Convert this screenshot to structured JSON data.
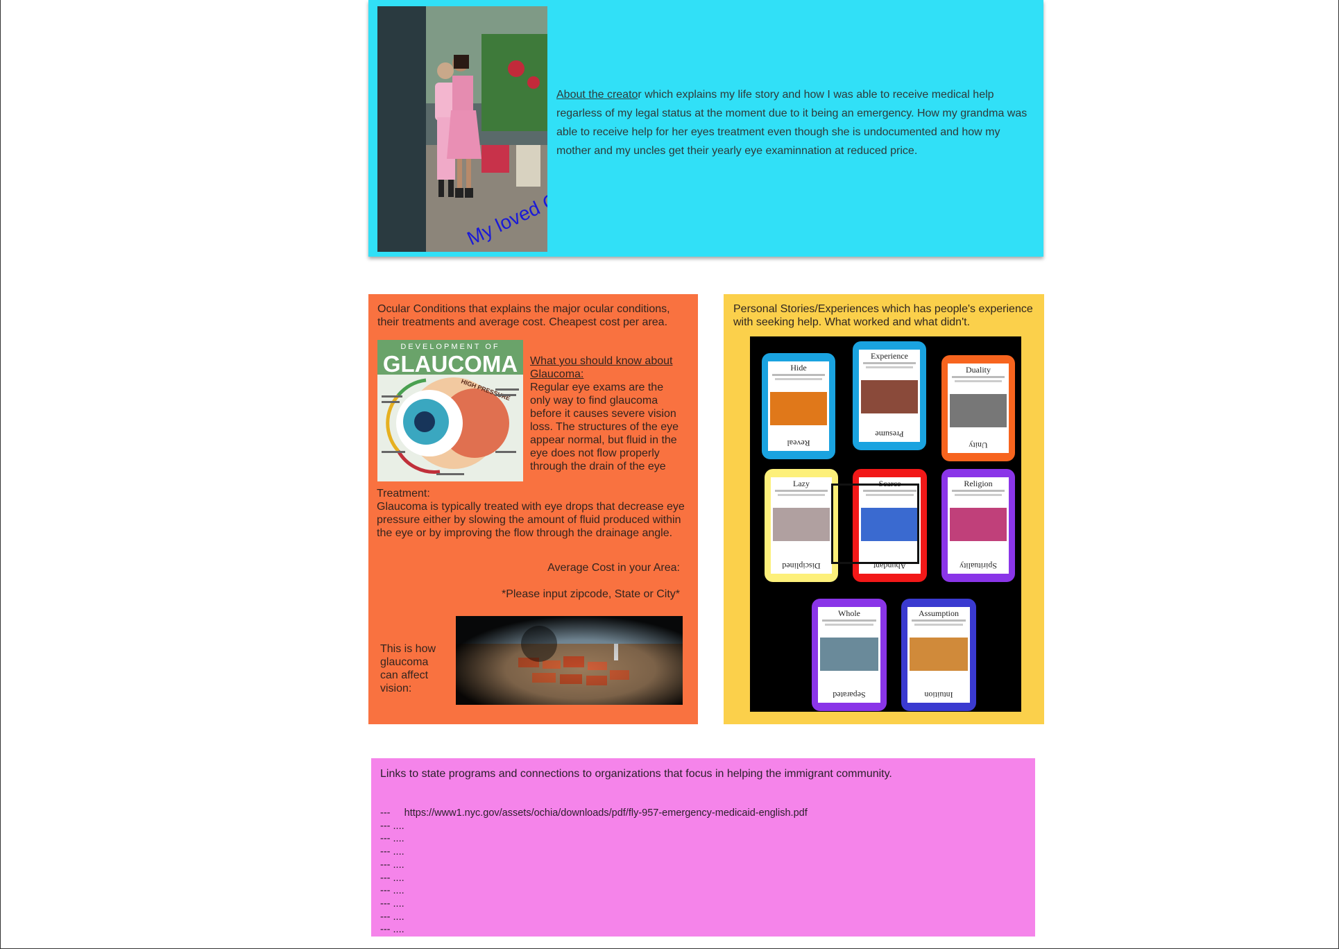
{
  "creator": {
    "photo_caption": "My loved Grandma",
    "link_text": "About the creato",
    "link_tail": "r",
    "text": " which explains my life story and how I was able to receive medical help regarless of my legal status at the moment due to it being an emergency.  How my grandma was able to receive help for her eyes treatment even though she is undocumented and how my mother and my uncles get their yearly eye examinnation at reduced price."
  },
  "ocular": {
    "intro": "Ocular Conditions that explains the major ocular conditions, their treatments and average cost. Cheapest cost per area.",
    "image": {
      "banner_top": "DEVELOPMENT OF",
      "banner_main": "GLAUCOMA",
      "arc_label": "HIGH PRESSURE"
    },
    "know_title": "What you should know about Glaucoma:",
    "know_text": "Regular eye exams are the only way to find glaucoma before it causes severe vision loss. The structures of the eye appear normal, but fluid in the eye does not flow properly through the drain of the eye",
    "treatment_title": "Treatment:",
    "treatment_text": "Glaucoma is typically treated with eye drops that decrease eye pressure either by slowing the amount of fluid produced within the eye or by improving the flow through the drainage angle.",
    "avg_cost": "Average Cost in your Area:",
    "zip_prompt": "*Please input zipcode, State or City*",
    "vision_label": "This is how glaucoma can affect vision:"
  },
  "stories": {
    "intro": "Personal Stories/Experiences which has people's experience with seeking help. What worked and what didn't.",
    "cards": [
      {
        "title": "Hide",
        "footer": "Reveal",
        "color": "#1aa3e0",
        "img": "#e0781a"
      },
      {
        "title": "Experience",
        "footer": "Presume",
        "color": "#1aa3e0",
        "img": "#8a4a3a"
      },
      {
        "title": "Duality",
        "footer": "Unity",
        "color": "#f7641e",
        "img": "#777777"
      },
      {
        "title": "Lazy",
        "footer": "Disciplined",
        "color": "#fdf07a",
        "img": "#b0a0a0"
      },
      {
        "title": "Scarce",
        "footer": "Abundant",
        "color": "#f21818",
        "img": "#3a6ad0"
      },
      {
        "title": "Religion",
        "footer": "Spirituality",
        "color": "#8a35e8",
        "img": "#c0407a"
      },
      {
        "title": "Whole",
        "footer": "Separated",
        "color": "#8a35e8",
        "img": "#6a8a9a"
      },
      {
        "title": "Assumption",
        "footer": "Intuition",
        "color": "#3a3ad0",
        "img": "#d08a3a"
      }
    ]
  },
  "links": {
    "title": "Links to state programs and connections to organizations that focus in helping the immigrant community.",
    "first": "---     https://www1.nyc.gov/assets/ochia/downloads/pdf/fly-957-emergency-medicaid-english.pdf",
    "rows": [
      "--- ....",
      "--- ....",
      "--- ....",
      "--- ....",
      "--- ....",
      "--- ....",
      "--- ....",
      "--- ....",
      "--- ...."
    ]
  }
}
